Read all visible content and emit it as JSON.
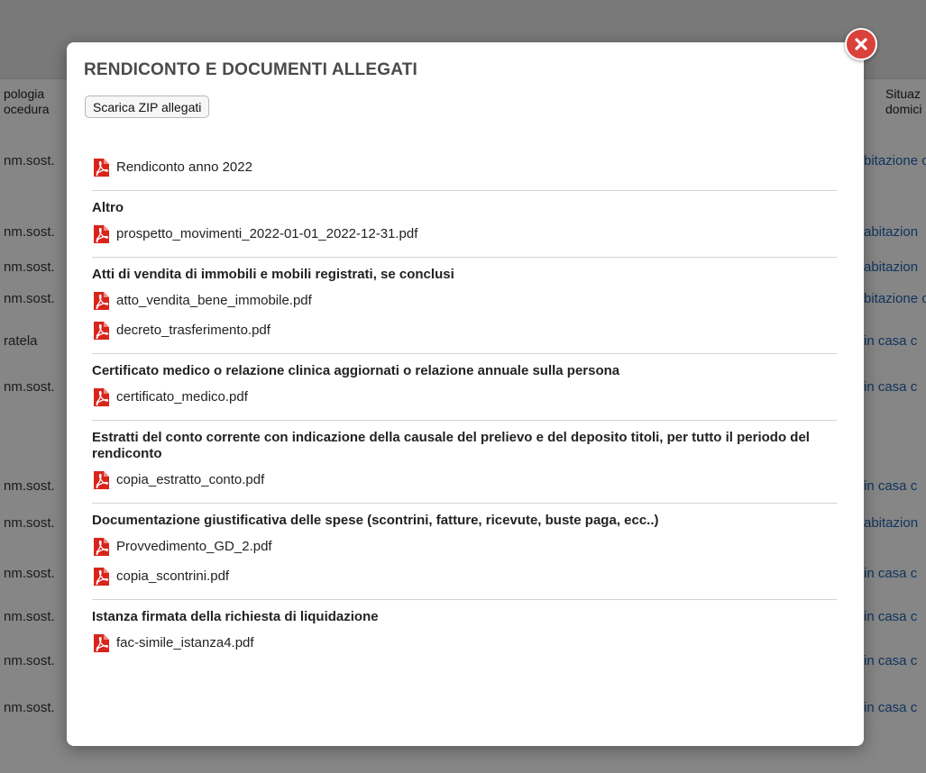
{
  "background": {
    "header_left": [
      "pologia",
      "ocedura"
    ],
    "header_right": [
      "Situaz",
      "domici"
    ],
    "rows": [
      {
        "left": "nm.sost.",
        "right": "bitazione c"
      },
      {
        "left": "nm.sost.",
        "right": "abitazion"
      },
      {
        "left": "nm.sost.",
        "right": "abitazion"
      },
      {
        "left": "nm.sost.",
        "right": "bitazione c"
      },
      {
        "left": "ratela",
        "right": "in casa c"
      },
      {
        "left": "nm.sost.",
        "right": "in casa c"
      },
      {
        "left": "nm.sost.",
        "right": "in casa c"
      },
      {
        "left": "nm.sost.",
        "right": "abitazion"
      },
      {
        "left": "nm.sost.",
        "right": "in casa c"
      },
      {
        "left": "nm.sost.",
        "right": "in casa c"
      },
      {
        "left": "nm.sost.",
        "right": "in casa c"
      },
      {
        "left": "nm.sost.",
        "right": "in casa c"
      }
    ]
  },
  "modal": {
    "title": "RENDICONTO E DOCUMENTI ALLEGATI",
    "zip_button": "Scarica ZIP allegati",
    "close_icon": "close-x-icon",
    "main_file": "Rendiconto anno 2022",
    "sections": [
      {
        "title": "Altro",
        "files": [
          "prospetto_movimenti_2022-01-01_2022-12-31.pdf"
        ]
      },
      {
        "title": "Atti di vendita di immobili e mobili registrati, se conclusi",
        "files": [
          "atto_vendita_bene_immobile.pdf",
          "decreto_trasferimento.pdf"
        ]
      },
      {
        "title": "Certificato medico o relazione clinica aggiornati o relazione annuale sulla persona",
        "files": [
          "certificato_medico.pdf"
        ]
      },
      {
        "title": "Estratti del conto corrente con indicazione della causale del prelievo e del deposito titoli, per tutto il periodo del rendiconto",
        "files": [
          "copia_estratto_conto.pdf"
        ]
      },
      {
        "title": "Documentazione giustificativa delle spese (scontrini, fatture, ricevute, buste paga, ecc..)",
        "files": [
          "Provvedimento_GD_2.pdf",
          "copia_scontrini.pdf"
        ]
      },
      {
        "title": "Istanza firmata della richiesta di liquidazione",
        "files": [
          "fac-simile_istanza4.pdf"
        ]
      }
    ]
  },
  "colors": {
    "pdf_icon": "#d9241b",
    "close_button": "#d9413a",
    "link_blue": "#1f5fa8"
  }
}
